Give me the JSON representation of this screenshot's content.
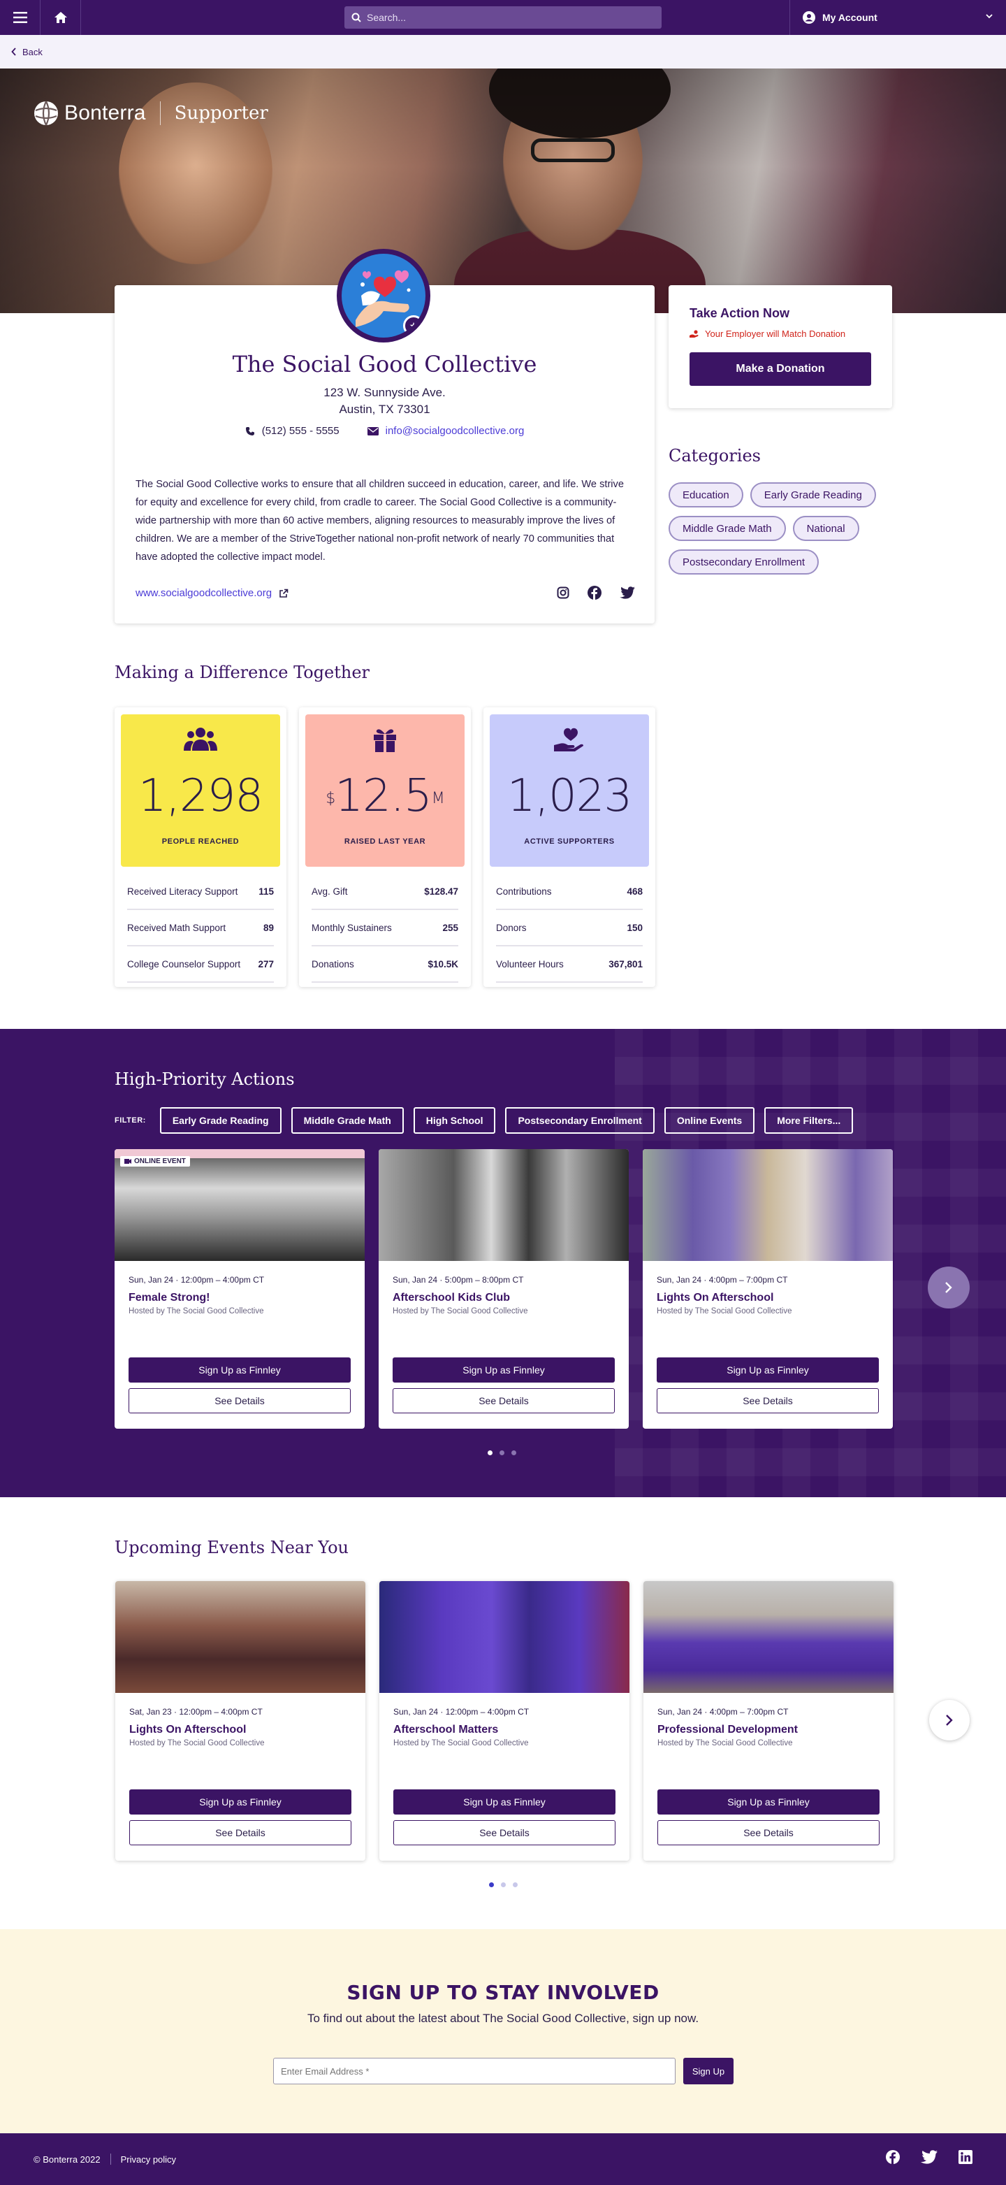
{
  "nav": {
    "search_placeholder": "Search...",
    "account_label": "My Account",
    "back_label": "Back"
  },
  "hero": {
    "brand": "Bonterra",
    "sub": "Supporter"
  },
  "org": {
    "name": "The Social Good Collective",
    "address_line1": "123 W. Sunnyside Ave.",
    "address_line2": "Austin, TX 73301",
    "phone": "(512) 555 - 5555",
    "email": "info@socialgoodcollective.org",
    "description": "The Social Good Collective works to ensure that all children succeed in education, career, and life. We strive for equity and excellence for every child, from cradle to career. The Social Good Collective is a community-wide partnership with more than 60 active members, aligning resources to measurably improve the lives of children. We are a member of the StriveTogether national non-profit network of nearly 70 communities that have adopted the collective impact model.",
    "website": "www.socialgoodcollective.org"
  },
  "take_action": {
    "title": "Take Action Now",
    "match": "Your Employer will Match Donation",
    "button": "Make a Donation"
  },
  "categories": {
    "title": "Categories",
    "items": [
      "Education",
      "Early Grade Reading",
      "Middle Grade Math",
      "National",
      "Postsecondary Enrollment"
    ]
  },
  "impact": {
    "title": "Making a Difference Together",
    "stats": [
      {
        "prefix": "",
        "value": "1,298",
        "suffix": "",
        "label": "PEOPLE REACHED",
        "color": "#f8e84a",
        "icon": "people-icon",
        "rows": [
          [
            "Received Literacy Support",
            "115"
          ],
          [
            "Received Math Support",
            "89"
          ],
          [
            "College Counselor Support",
            "277"
          ]
        ]
      },
      {
        "prefix": "$",
        "value": "12.5",
        "suffix": "M",
        "label": "RAISED LAST YEAR",
        "color": "#fdb7ab",
        "icon": "gift-icon",
        "rows": [
          [
            "Avg. Gift",
            "$128.47"
          ],
          [
            "Monthly Sustainers",
            "255"
          ],
          [
            "Donations",
            "$10.5K"
          ]
        ]
      },
      {
        "prefix": "",
        "value": "1,023",
        "suffix": "",
        "label": "ACTIVE SUPPORTERS",
        "color": "#c7cbfb",
        "icon": "heart-hand-icon",
        "rows": [
          [
            "Contributions",
            "468"
          ],
          [
            "Donors",
            "150"
          ],
          [
            "Volunteer Hours",
            "367,801"
          ]
        ]
      }
    ]
  },
  "high_priority": {
    "title": "High-Priority Actions",
    "filter_label": "FILTER:",
    "filters": [
      "Early Grade Reading",
      "Middle Grade Math",
      "High School",
      "Postsecondary Enrollment",
      "Online Events",
      "More Filters..."
    ],
    "events": [
      {
        "tag": "ONLINE EVENT",
        "date": "Sun, Jan 24 · 12:00pm – 4:00pm CT",
        "name": "Female Strong!",
        "host": "Hosted by The Social Good Collective",
        "btn1": "Sign Up as Finnley",
        "btn2": "See Details"
      },
      {
        "tag": "",
        "date": "Sun, Jan 24 · 5:00pm – 8:00pm CT",
        "name": "Afterschool Kids Club",
        "host": "Hosted by The Social Good Collective",
        "btn1": "Sign Up as Finnley",
        "btn2": "See Details"
      },
      {
        "tag": "",
        "date": "Sun, Jan 24 · 4:00pm – 7:00pm CT",
        "name": "Lights On Afterschool",
        "host": "Hosted by The Social Good Collective",
        "btn1": "Sign Up as Finnley",
        "btn2": "See Details"
      }
    ]
  },
  "upcoming": {
    "title": "Upcoming Events Near You",
    "events": [
      {
        "date": "Sat, Jan 23 · 12:00pm – 4:00pm CT",
        "name": "Lights On Afterschool",
        "host": "Hosted by The Social Good Collective",
        "btn1": "Sign Up as Finnley",
        "btn2": "See Details"
      },
      {
        "date": "Sun, Jan 24 · 12:00pm – 4:00pm CT",
        "name": "Afterschool Matters",
        "host": "Hosted by The Social Good Collective",
        "btn1": "Sign Up as Finnley",
        "btn2": "See Details"
      },
      {
        "date": "Sun, Jan 24 · 4:00pm – 7:00pm CT",
        "name": "Professional Development",
        "host": "Hosted by The Social Good Collective",
        "btn1": "Sign Up as Finnley",
        "btn2": "See Details"
      }
    ]
  },
  "signup": {
    "title": "SIGN UP TO STAY INVOLVED",
    "subtitle": "To find out about the latest about The Social Good Collective, sign up now.",
    "placeholder": "Enter Email Address *",
    "button": "Sign Up"
  },
  "footer": {
    "copyright": "© Bonterra 2022",
    "privacy": "Privacy policy"
  },
  "colors": {
    "brand": "#3b1464",
    "link": "#4b3bd6",
    "alert": "#d0241b",
    "signup_bg": "#fdf6e0"
  }
}
